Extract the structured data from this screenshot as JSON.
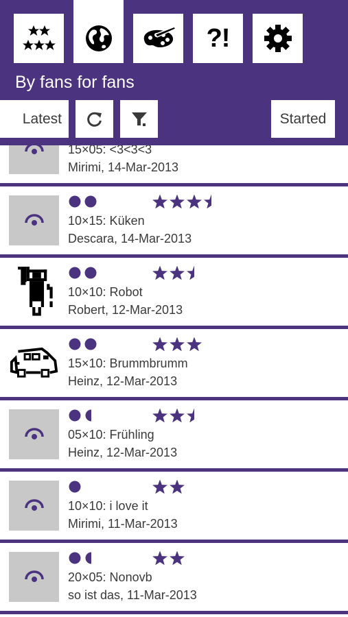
{
  "header": {
    "subtitle": "By fans for fans",
    "tabs": [
      {
        "icon": "stars-icon",
        "active": false
      },
      {
        "icon": "globe-icon",
        "active": true
      },
      {
        "icon": "palette-icon",
        "active": false
      },
      {
        "label": "?!",
        "active": false
      },
      {
        "icon": "gear-icon",
        "active": false
      }
    ]
  },
  "toolbar": {
    "latest_label": "Latest",
    "refresh_icon": "refresh-icon",
    "filter_icon": "filter-icon",
    "started_label": "Started"
  },
  "colors": {
    "accent": "#4b3380",
    "thumb_placeholder": "#c8c8c8",
    "text": "#3a3a3a"
  },
  "puzzles": [
    {
      "name": "15×05: <3<3<3",
      "meta": "Mirimi, 14-Mar-2013",
      "difficulty": 0,
      "rating": 0,
      "thumb": "placeholder"
    },
    {
      "name": "10×15: Küken",
      "meta": "Descara, 14-Mar-2013",
      "difficulty": 2,
      "rating": 3.5,
      "thumb": "placeholder"
    },
    {
      "name": "10×10: Robot",
      "meta": "Robert, 12-Mar-2013",
      "difficulty": 2,
      "rating": 2.5,
      "thumb": "robot"
    },
    {
      "name": "15×10: Brummbrumm",
      "meta": "Heinz, 12-Mar-2013",
      "difficulty": 2,
      "rating": 3,
      "thumb": "car"
    },
    {
      "name": "05×10: Frühling",
      "meta": "Heinz, 12-Mar-2013",
      "difficulty": 1.5,
      "rating": 2.5,
      "thumb": "placeholder"
    },
    {
      "name": "10×10: i love it",
      "meta": "Mirimi, 11-Mar-2013",
      "difficulty": 1,
      "rating": 2,
      "thumb": "placeholder"
    },
    {
      "name": "20×05: Nonovb",
      "meta": "so ist das, 11-Mar-2013",
      "difficulty": 1.5,
      "rating": 2,
      "thumb": "placeholder"
    }
  ]
}
